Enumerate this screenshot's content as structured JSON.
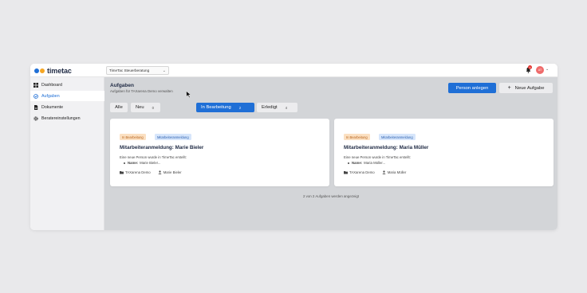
{
  "app": {
    "logo_text": "timetac",
    "logo_colors": [
      "#1f6fd6",
      "#f5a623"
    ],
    "workspace_select": "TimeTac Steuerberatung",
    "notification_count": "3",
    "avatar_initials": "AT"
  },
  "sidebar": {
    "items": [
      {
        "label": "Dashboard",
        "icon": "dashboard-icon",
        "active": false
      },
      {
        "label": "Aufgaben",
        "icon": "check-circle-icon",
        "active": true
      },
      {
        "label": "Dokumente",
        "icon": "document-icon",
        "active": false
      },
      {
        "label": "Beratereinstellungen",
        "icon": "gear-icon",
        "active": false
      }
    ]
  },
  "main": {
    "title": "Aufgaben",
    "subtitle": "Aufgaben für TAXarena Demo verwalten",
    "primary_button": "Person anlegen",
    "secondary_button": "Neue Aufgabe",
    "tabs": [
      {
        "label": "Alle",
        "count": ""
      },
      {
        "label": "Neu",
        "count": "0"
      },
      {
        "label": "In Bearbeitung",
        "count": "2"
      },
      {
        "label": "Erledigt",
        "count": "4"
      }
    ],
    "active_tab": "In Bearbeitung",
    "cards": [
      {
        "status": "In Bearbeitung",
        "type": "Mitarbeiteranmeldung",
        "title": "Mitarbeiteranmeldung: Marie Bieler",
        "description": "Eine neue Person wurde in TimeTac erstellt:",
        "bullet_label": "Name:",
        "bullet_value": "Marie Bieler...",
        "company": "TAXarena Demo",
        "person": "Marie Bieler"
      },
      {
        "status": "In Bearbeitung",
        "type": "Mitarbeiteranmeldung",
        "title": "Mitarbeiteranmeldung: Maria Müller",
        "description": "Eine neue Person wurde in TimeTac erstellt:",
        "bullet_label": "Name:",
        "bullet_value": "Maria Müller...",
        "company": "TAXarena Demo",
        "person": "Maria Müller"
      }
    ],
    "footer_note": "2 von 2 Aufgaben werden angezeigt"
  },
  "colors": {
    "accent": "#1f6fd6",
    "status_badge_bg": "#fbe0c2",
    "type_badge_bg": "#d7e6fb"
  }
}
